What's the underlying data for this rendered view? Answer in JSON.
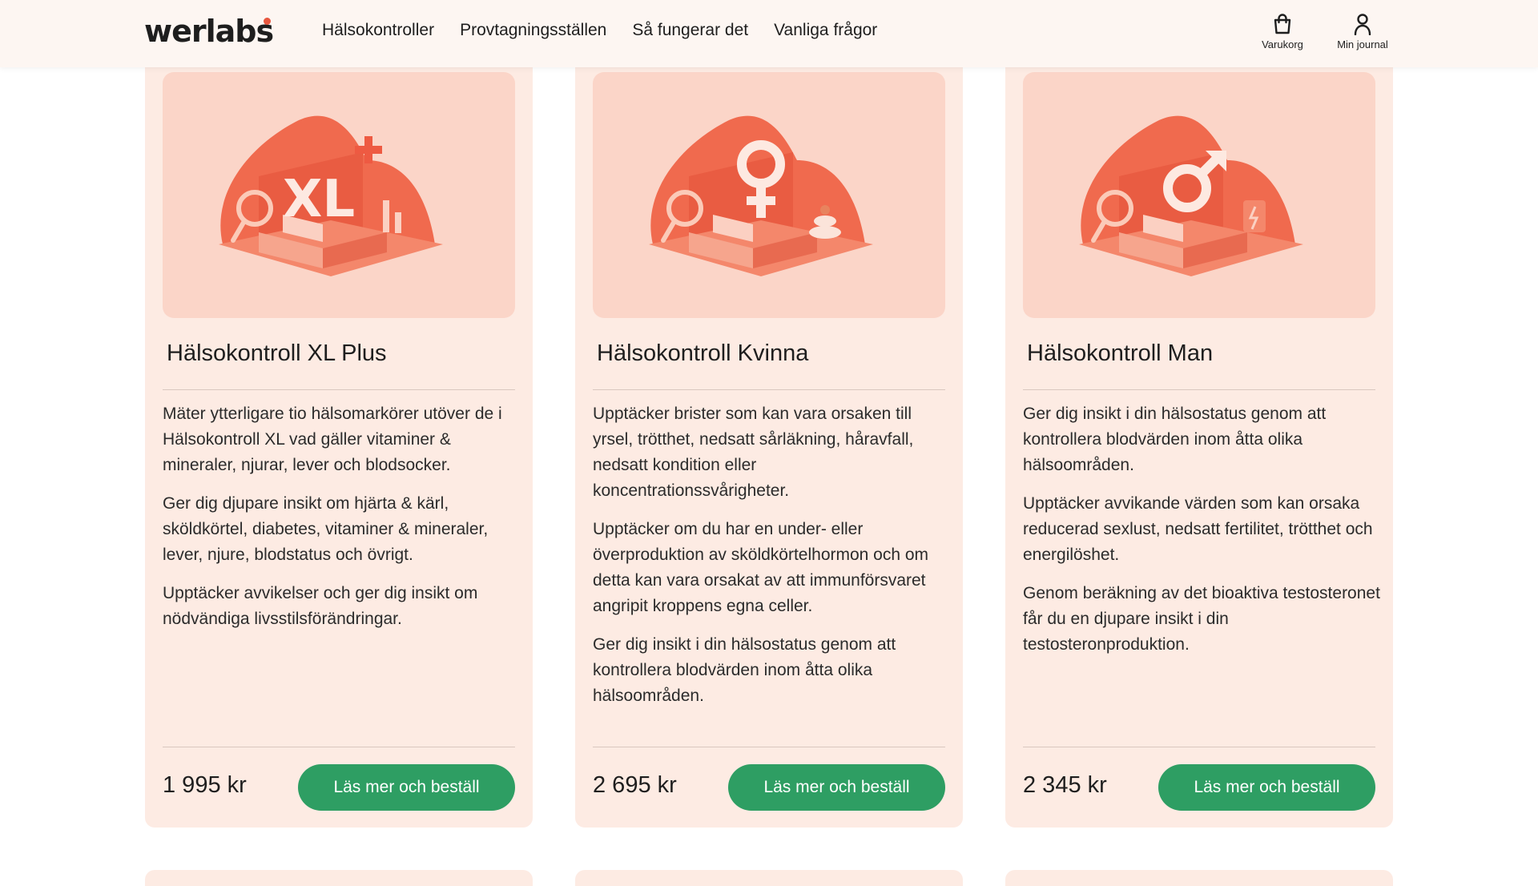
{
  "header": {
    "logo": "werlabs",
    "nav": [
      "Hälsokontroller",
      "Provtagningsställen",
      "Så fungerar det",
      "Vanliga frågor"
    ],
    "cart_label": "Varukorg",
    "journal_label": "Min journal"
  },
  "colors": {
    "accent": "#e8573f",
    "button": "#2e9e63",
    "card_bg": "#fdebe3",
    "image_bg": "#fbd5c8"
  },
  "cards": [
    {
      "image_icon": "xl-plus-illustration",
      "title": "Hälsokontroll XL Plus",
      "paragraphs": [
        "Mäter ytterligare tio hälsomarkörer utöver de i Hälsokontroll XL vad gäller vitaminer & mineraler, njurar, lever och blodsocker.",
        "Ger dig djupare insikt om hjärta & kärl, sköldkörtel, diabetes, vitaminer & mineraler, lever, njure, blodstatus och övrigt.",
        "Upptäcker avvikelser och ger dig insikt om nödvändiga livsstilsförändringar."
      ],
      "price": "1 995 kr",
      "button": "Läs mer och beställ"
    },
    {
      "image_icon": "female-symbol-illustration",
      "title": "Hälsokontroll Kvinna",
      "paragraphs": [
        "Upptäcker brister som kan vara orsaken till yrsel, trötthet, nedsatt sårläkning, håravfall, nedsatt kondition eller koncentrationssvårigheter.",
        "Upptäcker om du har en under- eller överproduktion av sköldkörtelhormon och om detta kan vara orsakat av att immunförsvaret angripit kroppens egna celler.",
        "Ger dig insikt i din hälsostatus genom att kontrollera blodvärden inom åtta olika hälsoområden."
      ],
      "price": "2 695 kr",
      "button": "Läs mer och beställ"
    },
    {
      "image_icon": "male-symbol-illustration",
      "title": "Hälsokontroll Man",
      "paragraphs": [
        "Ger dig insikt i din hälsostatus genom att kontrollera blodvärden inom åtta olika hälsoområden.",
        "Upptäcker avvikande värden som kan orsaka reducerad sexlust, nedsatt fertilitet, trötthet och energilöshet.",
        "Genom beräkning av det bioaktiva testosteronet får du en djupare insikt i din testosteronproduktion."
      ],
      "price": "2 345 kr",
      "button": "Läs mer och beställ"
    }
  ]
}
